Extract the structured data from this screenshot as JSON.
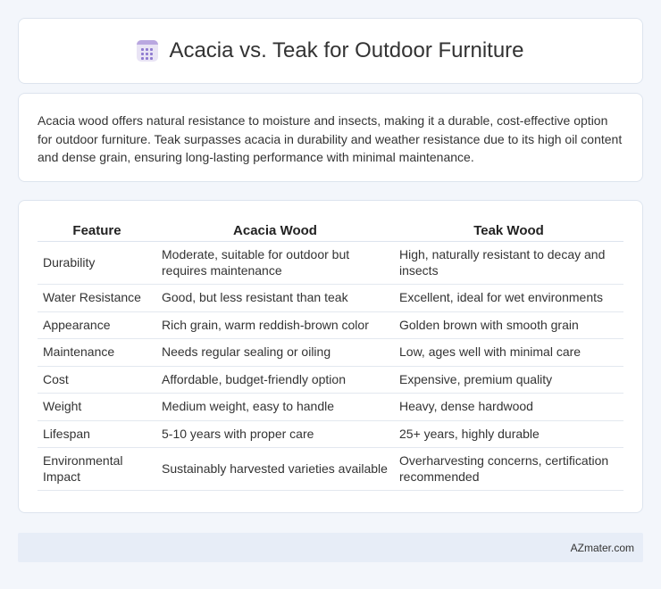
{
  "header": {
    "title": "Acacia vs. Teak for Outdoor Furniture",
    "icon": "calculator-icon"
  },
  "intro": {
    "text": "Acacia wood offers natural resistance to moisture and insects, making it a durable, cost-effective option for outdoor furniture. Teak surpasses acacia in durability and weather resistance due to its high oil content and dense grain, ensuring long-lasting performance with minimal maintenance."
  },
  "table": {
    "headers": [
      "Feature",
      "Acacia Wood",
      "Teak Wood"
    ],
    "rows": [
      [
        "Durability",
        "Moderate, suitable for outdoor but requires maintenance",
        "High, naturally resistant to decay and insects"
      ],
      [
        "Water Resistance",
        "Good, but less resistant than teak",
        "Excellent, ideal for wet environments"
      ],
      [
        "Appearance",
        "Rich grain, warm reddish-brown color",
        "Golden brown with smooth grain"
      ],
      [
        "Maintenance",
        "Needs regular sealing or oiling",
        "Low, ages well with minimal care"
      ],
      [
        "Cost",
        "Affordable, budget-friendly option",
        "Expensive, premium quality"
      ],
      [
        "Weight",
        "Medium weight, easy to handle",
        "Heavy, dense hardwood"
      ],
      [
        "Lifespan",
        "5-10 years with proper care",
        "25+ years, highly durable"
      ],
      [
        "Environmental Impact",
        "Sustainably harvested varieties available",
        "Overharvesting concerns, certification recommended"
      ]
    ]
  },
  "footer": {
    "site": "AZmater.com"
  },
  "colors": {
    "background": "#f3f6fb",
    "footer_bg": "#e7edf7",
    "icon_accent": "#b9a7e0"
  }
}
